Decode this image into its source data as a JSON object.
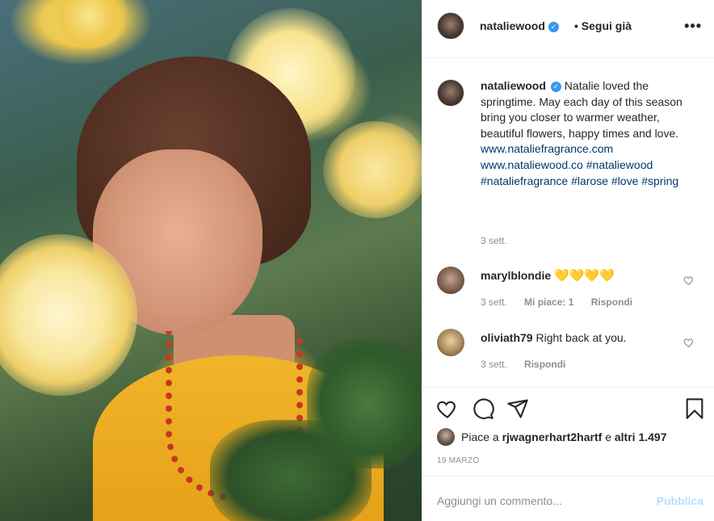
{
  "header": {
    "username": "nataliewood",
    "follow_status": "• Segui già",
    "more_label": "•••"
  },
  "caption": {
    "username": "nataliewood",
    "text": "Natalie loved the springtime. May each day of this season bring you closer to warmer weather, beautiful flowers, happy times and love.",
    "link1": "www.nataliefragrance.com",
    "link2": "www.nataliewood.co",
    "tags": [
      "#nataliewood",
      "#nataliefragrance",
      "#larose",
      "#love",
      "#spring"
    ],
    "time": "3 sett."
  },
  "comments": [
    {
      "username": "marylblondie",
      "text": "💛💛💛💛",
      "time": "3 sett.",
      "likes": "Mi piace: 1",
      "reply": "Rispondi"
    },
    {
      "username": "oliviath79",
      "text": "Right back at you.",
      "time": "3 sett.",
      "reply": "Rispondi"
    }
  ],
  "likes": {
    "prefix": "Piace a",
    "user": "rjwagnerhart2hartf",
    "connector": "e",
    "others": "altri 1.497"
  },
  "post_date": "19 MARZO",
  "add_comment": {
    "placeholder": "Aggiungi un commento...",
    "publish": "Pubblica"
  },
  "colors": {
    "link": "#00376b",
    "verified": "#3897f0",
    "publish_disabled": "#b2dffc",
    "meta": "#8e8e8e"
  },
  "icons": [
    "verified-badge-icon",
    "more-options-icon",
    "heart-icon",
    "comment-icon",
    "share-icon",
    "bookmark-icon"
  ]
}
